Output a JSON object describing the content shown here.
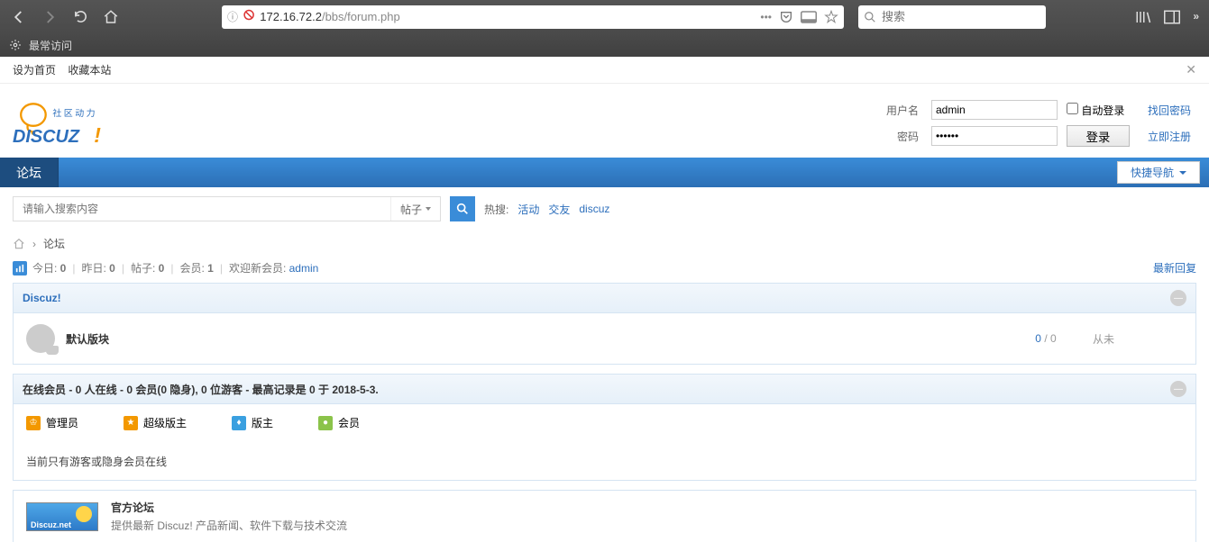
{
  "browser": {
    "url_host": "172.16.72.2",
    "url_path": "/bbs/forum.php",
    "search_placeholder": "搜索",
    "bookmarks_label": "最常访问"
  },
  "top_links": {
    "set_home": "设为首页",
    "favorite": "收藏本站"
  },
  "logo": {
    "cn": "社区动力",
    "en": "DISCUZ!"
  },
  "login": {
    "username_label": "用户名",
    "password_label": "密码",
    "username_value": "admin",
    "password_value": "••••••",
    "auto_login": "自动登录",
    "find_pwd": "找回密码",
    "login_btn": "登录",
    "register": "立即注册"
  },
  "nav": {
    "forum": "论坛",
    "quick": "快捷导航"
  },
  "search": {
    "placeholder": "请输入搜索内容",
    "filter": "帖子",
    "hot_label": "热搜:",
    "hot1": "活动",
    "hot2": "交友",
    "hot3": "discuz"
  },
  "breadcrumb": {
    "forum": "论坛"
  },
  "stats": {
    "today_label": "今日:",
    "today_val": " 0",
    "yesterday_label": "昨日:",
    "yesterday_val": " 0",
    "posts_label": "帖子:",
    "posts_val": " 0",
    "members_label": "会员:",
    "members_val": " 1",
    "welcome_label": "欢迎新会员:",
    "welcome_user": "admin",
    "latest_reply": "最新回复"
  },
  "section1": {
    "title": "Discuz!",
    "forum_name": "默认版块",
    "num1": "0",
    "num2": "0",
    "last": "从未"
  },
  "online": {
    "header": "在线会员 - 0 人在线 - 0 会员(0 隐身), 0 位游客 - 最高记录是 0 于 2018-5-3.",
    "admin": "管理员",
    "super": "超级版主",
    "mod": "版主",
    "member": "会员",
    "empty": "当前只有游客或隐身会员在线"
  },
  "official": {
    "title": "官方论坛",
    "desc": "提供最新 Discuz! 产品新闻、软件下载与技术交流",
    "logo_text": "Discuz.net"
  }
}
